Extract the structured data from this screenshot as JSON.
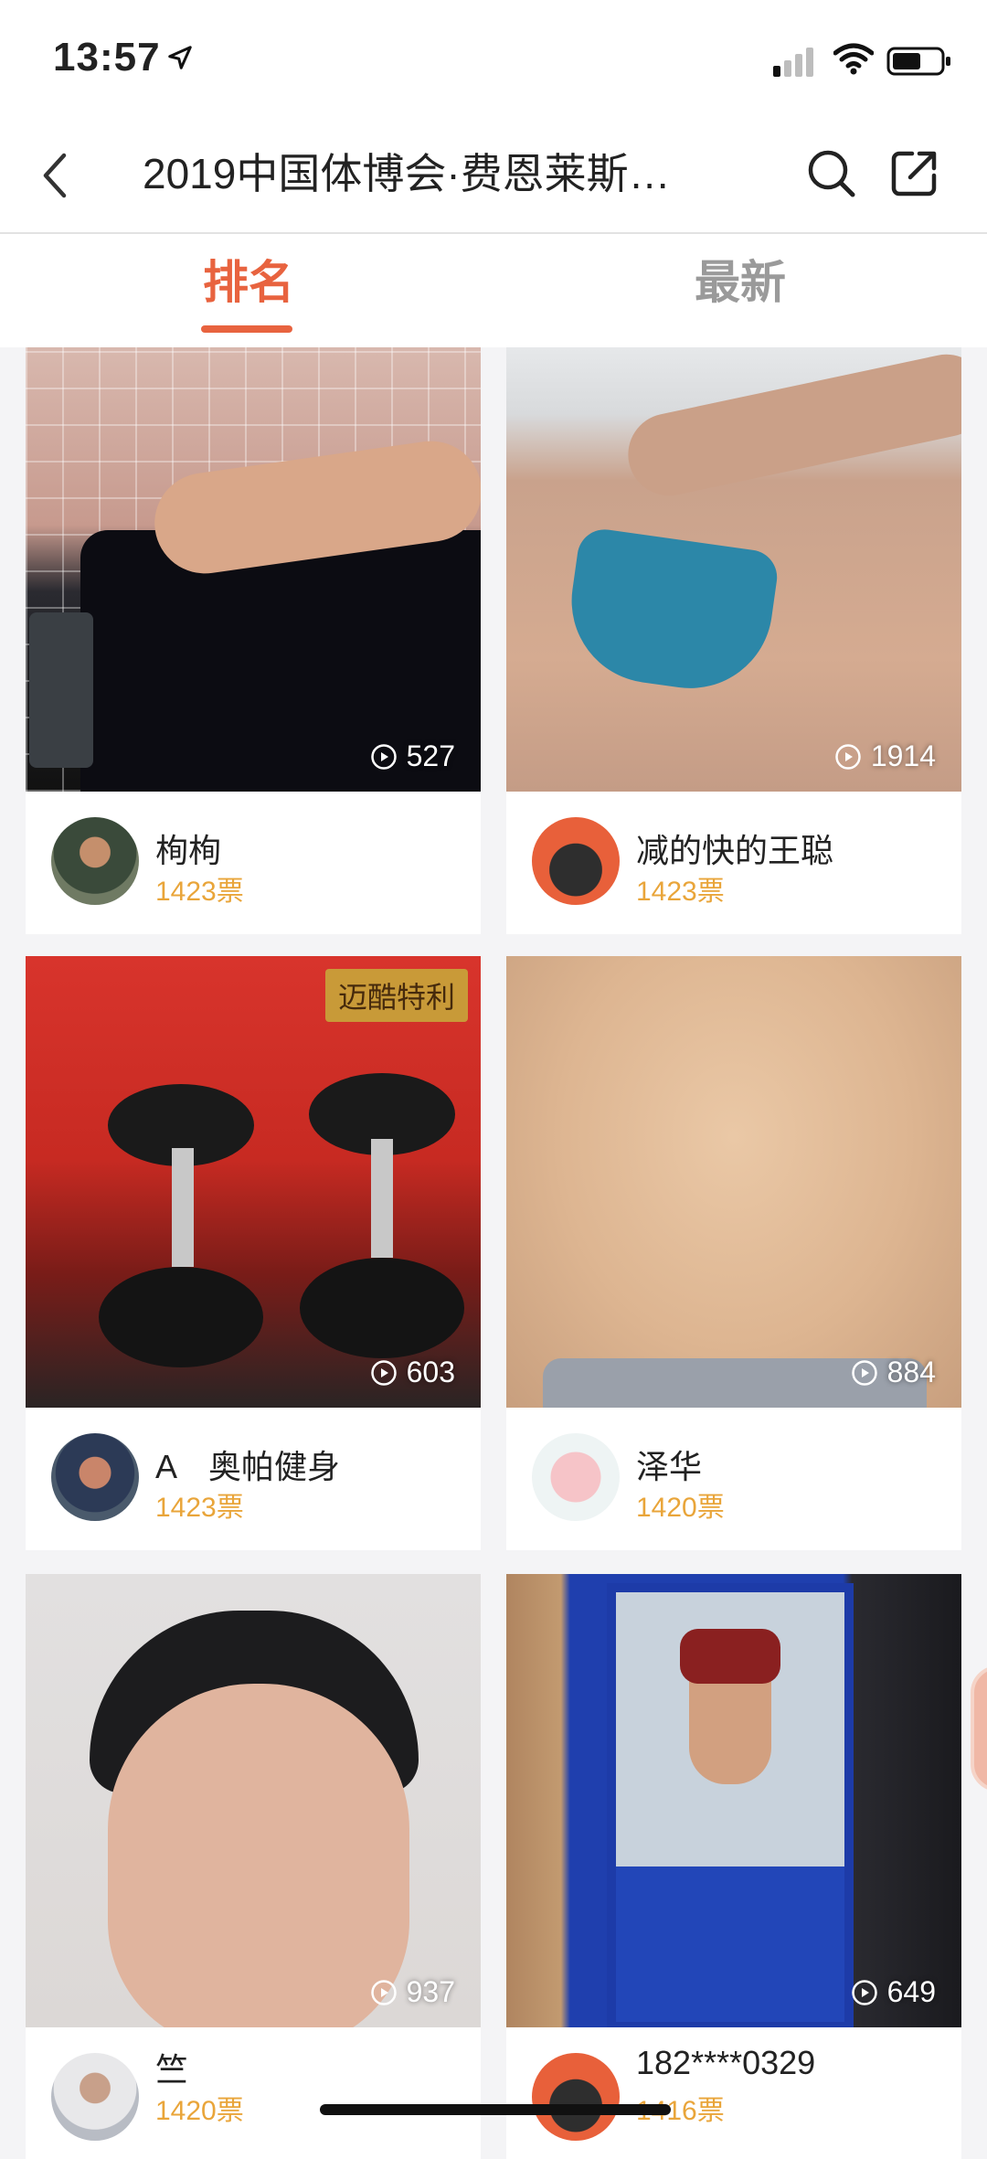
{
  "status_bar": {
    "time": "13:57"
  },
  "nav": {
    "title": "2019中国体博会·费恩莱斯…"
  },
  "tabs": [
    {
      "label": "排名"
    },
    {
      "label": "最新"
    }
  ],
  "cards": [
    {
      "name": "栒栒",
      "votes": "1423票",
      "plays": "527"
    },
    {
      "name": "减的快的王聪",
      "votes": "1423票",
      "plays": "1914"
    },
    {
      "name": "A　奥帕健身",
      "votes": "1423票",
      "plays": "603",
      "badge": "迈酷特利"
    },
    {
      "name": "泽华",
      "votes": "1420票",
      "plays": "884"
    },
    {
      "name": "竺",
      "votes": "1420票",
      "plays": "937"
    },
    {
      "name": "182****0329",
      "votes": "1416票",
      "plays": "649"
    }
  ],
  "colors": {
    "accent": "#e8633f",
    "votes": "#e9a53a",
    "tab_inactive": "#9a9a9a"
  }
}
